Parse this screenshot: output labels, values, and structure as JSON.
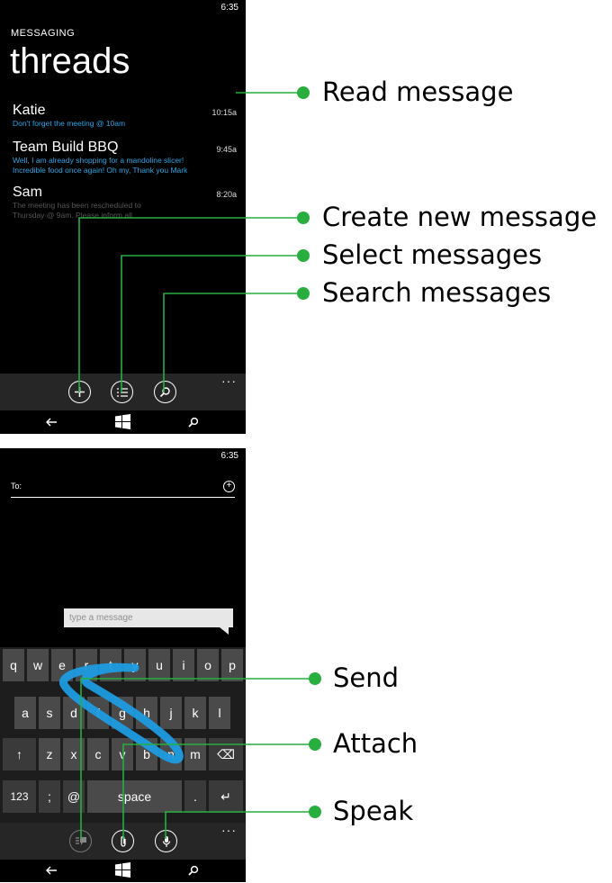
{
  "colors": {
    "accent": "#2aa6e6",
    "annotation_line": "#27ae3f",
    "phone_bg": "#000000"
  },
  "screen1": {
    "status_time": "6:35",
    "app_label": "MESSAGING",
    "page_title": "threads",
    "threads": [
      {
        "name": "Katie",
        "time": "10:15a",
        "preview": [
          "Don't forget the meeting @ 10am"
        ]
      },
      {
        "name": "Team Build BBQ",
        "time": "9:45a",
        "preview": [
          "Well, I am already shopping for a mandoline slicer!",
          "Incredible food once again! Oh my, Thank you Mark"
        ]
      },
      {
        "name": "Sam",
        "time": "8:20a",
        "preview": [
          "The meeting has been rescheduled to",
          "Thursday @ 9am. Please inform all"
        ]
      }
    ],
    "appbar": {
      "buttons": [
        "new-message-icon",
        "select-icon",
        "search-icon"
      ],
      "more": "···"
    },
    "nav": [
      "back-icon",
      "windows-icon",
      "search-icon"
    ]
  },
  "screen2": {
    "status_time": "6:35",
    "to_label": "To:",
    "compose_placeholder": "type a message",
    "keyboard": {
      "row1": [
        "q",
        "w",
        "e",
        "r",
        "t",
        "y",
        "u",
        "i",
        "o",
        "p"
      ],
      "row2": [
        "a",
        "s",
        "d",
        "f",
        "g",
        "h",
        "j",
        "k",
        "l"
      ],
      "row3": [
        "z",
        "x",
        "c",
        "v",
        "b",
        "n",
        "m"
      ],
      "row4": [
        "123",
        ";",
        "@",
        "space",
        ".",
        "↵"
      ],
      "shift": "↑",
      "backspace": "⌫"
    },
    "appbar": {
      "buttons": [
        "send-icon",
        "attach-icon",
        "microphone-icon"
      ],
      "more": "···"
    },
    "nav": [
      "back-icon",
      "windows-icon",
      "search-icon"
    ]
  },
  "annotations": [
    "Read message",
    "Create new message",
    "Select messages",
    "Search messages",
    "Send",
    "Attach",
    "Speak"
  ]
}
